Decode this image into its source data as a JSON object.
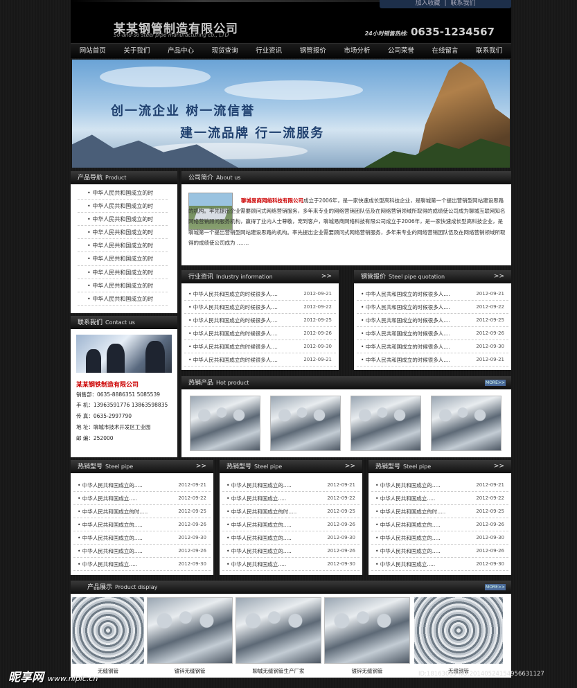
{
  "header": {
    "toplinks": [
      "加入收藏",
      "联系我们"
    ],
    "logo_cn": "某某钢管制造有限公司",
    "logo_en": "So-and-so steel pipe manufacturing co., LTD",
    "hotline_label": "24小时销售热线:",
    "hotline": "0635-1234567"
  },
  "nav": [
    "网站首页",
    "关于我们",
    "产品中心",
    "现货查询",
    "行业资讯",
    "钢管报价",
    "市场分析",
    "公司荣誉",
    "在线留言",
    "联系我们"
  ],
  "banner": {
    "slogan1": "创一流企业  树一流信誉",
    "slogan2": "建一流品牌  行一流服务"
  },
  "product_nav": {
    "title": "产品导航",
    "title_en": "Product",
    "items": [
      "中华人民共和国成立的时",
      "中华人民共和国成立的时",
      "中华人民共和国成立的时",
      "中华人民共和国成立的时",
      "中华人民共和国成立的时",
      "中华人民共和国成立的时",
      "中华人民共和国成立的时",
      "中华人民共和国成立的时",
      "中华人民共和国成立的时"
    ]
  },
  "contact": {
    "title": "联系我们",
    "title_en": "Contact us",
    "company": "某某钢铁制造有限公司",
    "rows": [
      "销售部：0635-8886351   5085539",
      "手   机：13963591776   13863598835",
      "传   真：0635-2997790",
      "地   址：聊城市技术开发区工业园",
      "邮   编：252000"
    ]
  },
  "about": {
    "title": "公司简介",
    "title_en": "About us",
    "company": "聊城易商网络科技有限公司",
    "text": "成立于2006年，是一家快速成长型高科技企业，是聊城第一个提出营销型网站建设思路的机构。率先提出企业需要顾问式网络营销服务，多年来专业的网络营销团队伍及在网络营销领域所取得的成绩使公司成为聊城互联网知名网络营销顾问服务机构，赢得了业内人士尊敬，宠到客户，聊城易商网络科技有限公司成立于2006年，是一家快速成长型高科技企业，是聊城第一个提出营销型网站建设思路的机构。率先提出企业需要顾问式网络营销服务，多年来专业的网络营销团队伍及在网络营销领域所取得的成绩使公司成为 ……."
  },
  "industry": {
    "title": "行业资讯",
    "title_en": "Industry information",
    "more": ">>",
    "items": [
      {
        "t": "中华人民共和国成立的时候很多人....",
        "d": "2012-09-21"
      },
      {
        "t": "中华人民共和国成立的时候很多人....",
        "d": "2012-09-22"
      },
      {
        "t": "中华人民共和国成立的时候很多人....",
        "d": "2012-09-25"
      },
      {
        "t": "中华人民共和国成立的时候很多人....",
        "d": "2012-09-26"
      },
      {
        "t": "中华人民共和国成立的时候很多人....",
        "d": "2012-09-30"
      },
      {
        "t": "中华人民共和国成立的时候很多人....",
        "d": "2012-09-21"
      }
    ]
  },
  "quotation": {
    "title": "钢管报价",
    "title_en": "Steel pipe quotation",
    "more": ">>",
    "items": [
      {
        "t": "中华人民共和国成立的时候很多人....",
        "d": "2012-09-21"
      },
      {
        "t": "中华人民共和国成立的时候很多人....",
        "d": "2012-09-22"
      },
      {
        "t": "中华人民共和国成立的时候很多人....",
        "d": "2012-09-25"
      },
      {
        "t": "中华人民共和国成立的时候很多人....",
        "d": "2012-09-26"
      },
      {
        "t": "中华人民共和国成立的时候很多人....",
        "d": "2012-09-30"
      },
      {
        "t": "中华人民共和国成立的时候很多人....",
        "d": "2012-09-21"
      }
    ]
  },
  "hot_product": {
    "title": "热销产品",
    "title_en": "Hot product",
    "more": "MORE>>"
  },
  "steel_cols": [
    {
      "title": "热销型号",
      "title_en": "Steel pipe",
      "more": ">>",
      "items": [
        {
          "t": "中华人民共和国成立的.....",
          "d": "2012-09-21"
        },
        {
          "t": "中华人民共和国成立.....",
          "d": "2012-09-22"
        },
        {
          "t": "中华人民共和国成立的时.....",
          "d": "2012-09-25"
        },
        {
          "t": "中华人民共和国成立的.....",
          "d": "2012-09-26"
        },
        {
          "t": "中华人民共和国成立的.....",
          "d": "2012-09-30"
        },
        {
          "t": "中华人民共和国成立的.....",
          "d": "2012-09-26"
        },
        {
          "t": "中华人民共和国成立.....",
          "d": "2012-09-30"
        }
      ]
    },
    {
      "title": "热销型号",
      "title_en": "Steel pipe",
      "more": ">>",
      "items": [
        {
          "t": "中华人民共和国成立的.....",
          "d": "2012-09-21"
        },
        {
          "t": "中华人民共和国成立.....",
          "d": "2012-09-22"
        },
        {
          "t": "中华人民共和国成立的时.....",
          "d": "2012-09-25"
        },
        {
          "t": "中华人民共和国成立的.....",
          "d": "2012-09-26"
        },
        {
          "t": "中华人民共和国成立的.....",
          "d": "2012-09-30"
        },
        {
          "t": "中华人民共和国成立的.....",
          "d": "2012-09-26"
        },
        {
          "t": "中华人民共和国成立.....",
          "d": "2012-09-30"
        }
      ]
    },
    {
      "title": "热销型号",
      "title_en": "Steel pipe",
      "more": ">>",
      "items": [
        {
          "t": "中华人民共和国成立的.....",
          "d": "2012-09-21"
        },
        {
          "t": "中华人民共和国成立.....",
          "d": "2012-09-22"
        },
        {
          "t": "中华人民共和国成立的时.....",
          "d": "2012-09-25"
        },
        {
          "t": "中华人民共和国成立的.....",
          "d": "2012-09-26"
        },
        {
          "t": "中华人民共和国成立的.....",
          "d": "2012-09-30"
        },
        {
          "t": "中华人民共和国成立的.....",
          "d": "2012-09-26"
        },
        {
          "t": "中华人民共和国成立.....",
          "d": "2012-09-30"
        }
      ]
    }
  ],
  "display": {
    "title": "产品展示",
    "title_en": "Product display",
    "more": "MORE>>",
    "labels": [
      "无缝钢管",
      "镀锌无缝钢管",
      "聊城无缝钢管生产厂家",
      "镀锌无缝钢管",
      "无缝钢管"
    ]
  },
  "watermark": {
    "text": "昵享网",
    "url": "www.nipic.cn",
    "id": "ID:18163069 NO:20140524154956631127"
  }
}
